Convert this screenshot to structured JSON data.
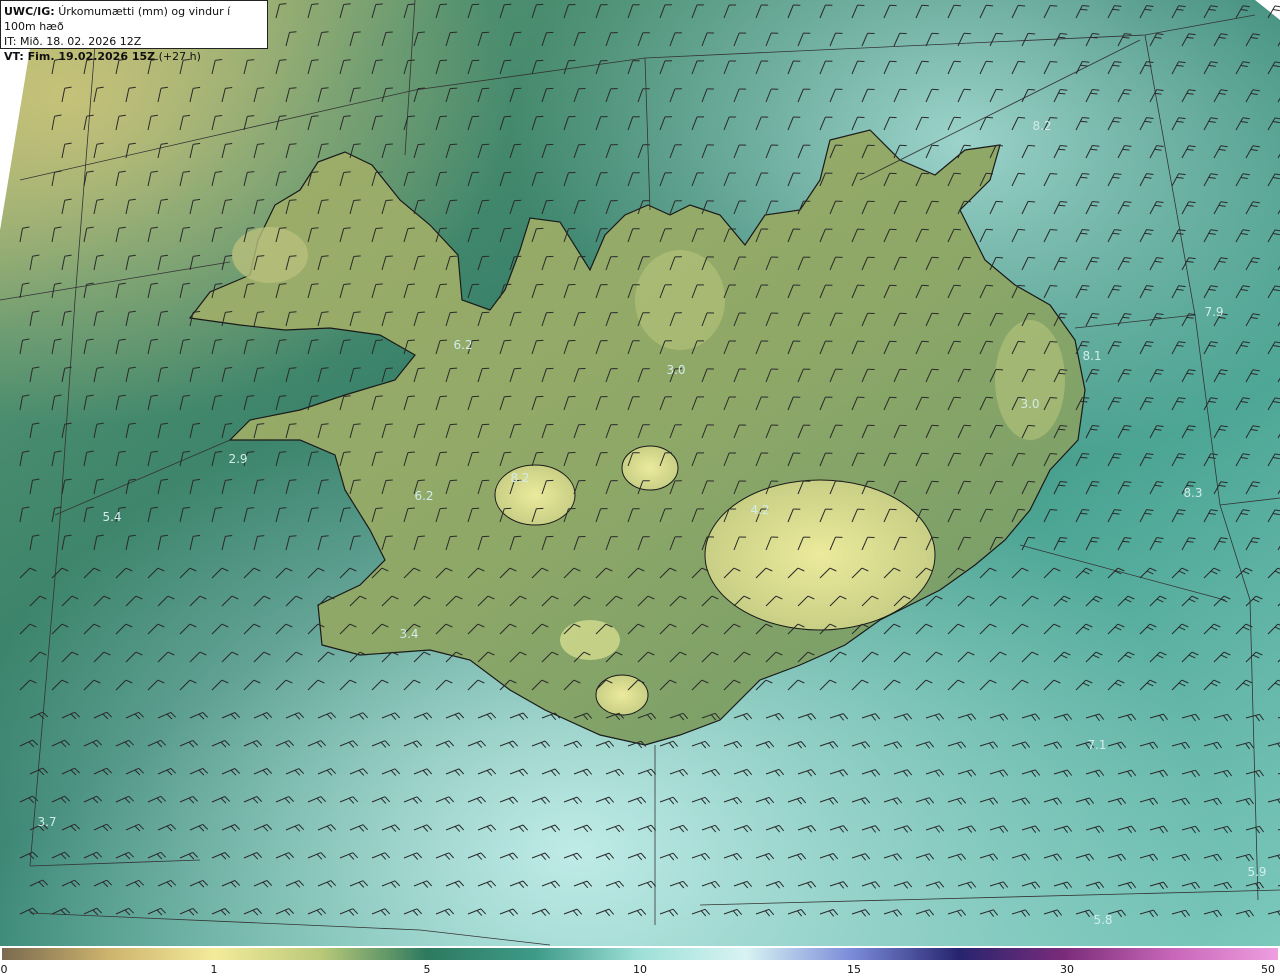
{
  "header": {
    "model": "UWC/IG:",
    "product": "Úrkomumætti (mm) og vindur í 100m hæð",
    "init_time": "IT: Mið. 18. 02. 2026 12Z",
    "valid_prefix": "VT: Fim. 19.02.2026 15Z",
    "valid_suffix": "(+27 h)"
  },
  "map_labels": [
    "8.2",
    "7.9",
    "8.1",
    "3.0",
    "6.2",
    "3.0",
    "2.9",
    "8.2",
    "6.2",
    "5.4",
    "4.2",
    "8.3",
    "3.4",
    "7.1",
    "3.7",
    "5.9",
    "5.8"
  ],
  "colorbar": {
    "ticks": [
      "0",
      "1",
      "5",
      "10",
      "15",
      "30",
      "50"
    ],
    "colors": [
      "#7a6a4f",
      "#cdb36d",
      "#f3eb9a",
      "#b9c978",
      "#2d7a5f",
      "#3e9a88",
      "#9ee0d8",
      "#d8f3f3",
      "#7a8ad8",
      "#27246e",
      "#7a2c7a",
      "#c866b8",
      "#ee9ee0"
    ]
  }
}
